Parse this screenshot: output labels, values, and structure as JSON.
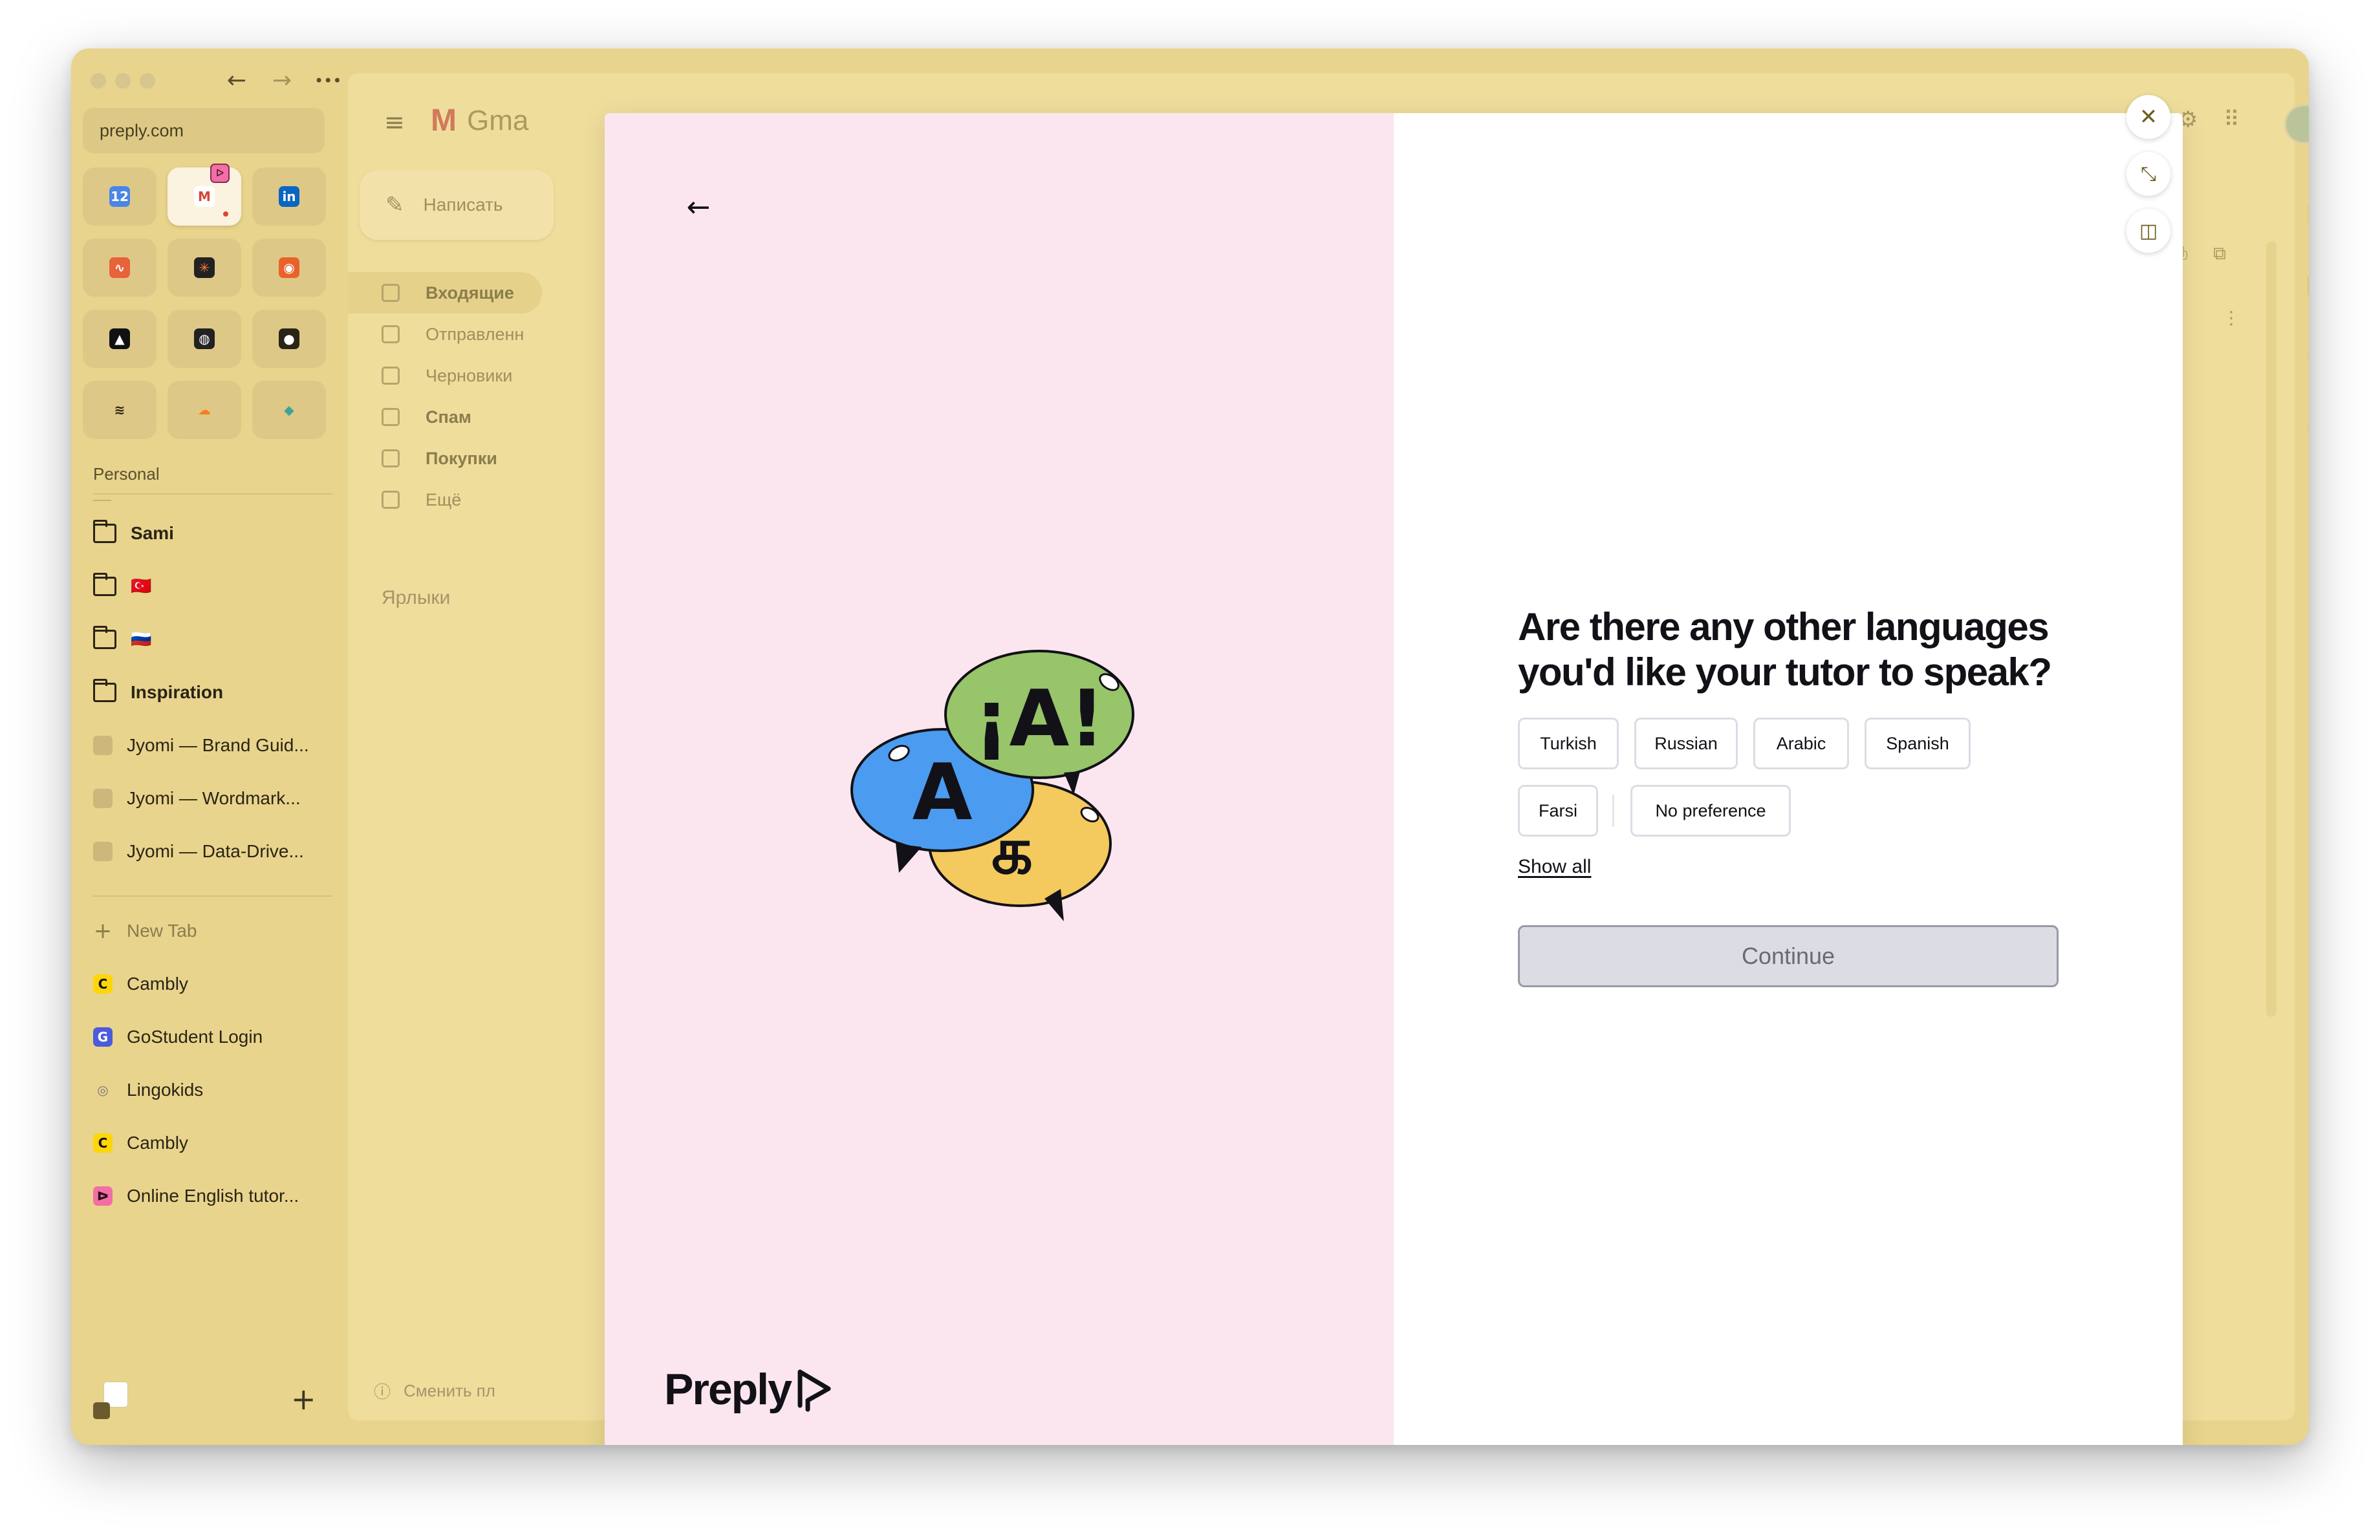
{
  "browser": {
    "url": "preply.com",
    "nav": {
      "back_icon": "←",
      "forward_icon": "→",
      "more_icon": "•••"
    },
    "favorites": [
      {
        "name": "calendar",
        "glyph": "12",
        "bg": "#4a86e8"
      },
      {
        "name": "gmail",
        "glyph": "M",
        "bg": "#ffffff",
        "color": "#d44638",
        "active": true,
        "badge": "ᐅ"
      },
      {
        "name": "linkedin",
        "glyph": "in",
        "bg": "#0a66c2"
      },
      {
        "name": "analytics",
        "glyph": "∿",
        "bg": "#e8623a"
      },
      {
        "name": "app-star",
        "glyph": "✳",
        "bg": "#222222",
        "color": "#ff7a3d"
      },
      {
        "name": "app-orange",
        "glyph": "◉",
        "bg": "#e8622a"
      },
      {
        "name": "app-triangle",
        "glyph": "▲",
        "bg": "#111111"
      },
      {
        "name": "app-o",
        "glyph": "◍",
        "bg": "#222222"
      },
      {
        "name": "github",
        "glyph": "●",
        "bg": "#2a2416"
      },
      {
        "name": "squarespace",
        "glyph": "≋",
        "bg": "transparent",
        "color": "#2a2416"
      },
      {
        "name": "cloudflare",
        "glyph": "☁",
        "bg": "transparent",
        "color": "#f38020"
      },
      {
        "name": "app-diamond",
        "glyph": "◆",
        "bg": "transparent",
        "color": "#3fa39a"
      }
    ],
    "section_label": "Personal",
    "items": [
      {
        "type": "folder",
        "label": "Sami",
        "bold": true
      },
      {
        "type": "folder",
        "label": "",
        "flag": "🇹🇷"
      },
      {
        "type": "folder",
        "label": "",
        "flag": "🇷🇺"
      },
      {
        "type": "folder",
        "label": "Inspiration",
        "bold": true
      },
      {
        "type": "doc",
        "label": "Jyomi — Brand Guid..."
      },
      {
        "type": "doc",
        "label": "Jyomi — Wordmark..."
      },
      {
        "type": "doc",
        "label": "Jyomi — Data-Drive..."
      }
    ],
    "new_tab": "New Tab",
    "tabs": [
      {
        "label": "Cambly",
        "glyph": "C",
        "bg": "#ffd60a",
        "color": "#111111"
      },
      {
        "label": "GoStudent Login",
        "glyph": "G",
        "bg": "#4b5bdc",
        "color": "#ffffff"
      },
      {
        "label": "Lingokids",
        "glyph": "◎",
        "bg": "transparent",
        "color": "#777777"
      },
      {
        "label": "Cambly",
        "glyph": "C",
        "bg": "#ffd60a",
        "color": "#111111"
      },
      {
        "label": "Online English tutor...",
        "glyph": "ᐅ",
        "bg": "#f26ea5",
        "color": "#2a0e1b"
      }
    ]
  },
  "gmail": {
    "logo_text": "Gma",
    "compose_label": "Написать",
    "nav": [
      {
        "label": "Входящие",
        "bold": true,
        "selected": true
      },
      {
        "label": "Отправленн",
        "bold": false
      },
      {
        "label": "Черновики",
        "bold": false
      },
      {
        "label": "Спам",
        "bold": true
      },
      {
        "label": "Покупки",
        "bold": true
      },
      {
        "label": "Ещё",
        "bold": false
      }
    ],
    "labels_heading": "Ярлыки",
    "footer_text": "Сменить пл"
  },
  "modal": {
    "back_icon": "←",
    "question": "Are there any other languages you'd like your tutor to speak?",
    "options": [
      "Turkish",
      "Russian",
      "Arabic",
      "Spanish",
      "Farsi",
      "No preference"
    ],
    "show_all": "Show all",
    "continue_label": "Continue",
    "brand": "Preply",
    "illustration": {
      "bubble_1": "¡A!",
      "bubble_2": "A",
      "bubble_3": "க"
    }
  },
  "controls": {
    "close_icon": "✕",
    "expand_icon": "⤡",
    "split_icon": "◫"
  },
  "colors": {
    "window_bg": "#e8d48c",
    "modal_left_bg": "#fbe6ef",
    "bubble_green": "#98c46a",
    "bubble_blue": "#4b9bf0",
    "bubble_yellow": "#f4c95d",
    "continue_bg": "#dcdce5"
  }
}
